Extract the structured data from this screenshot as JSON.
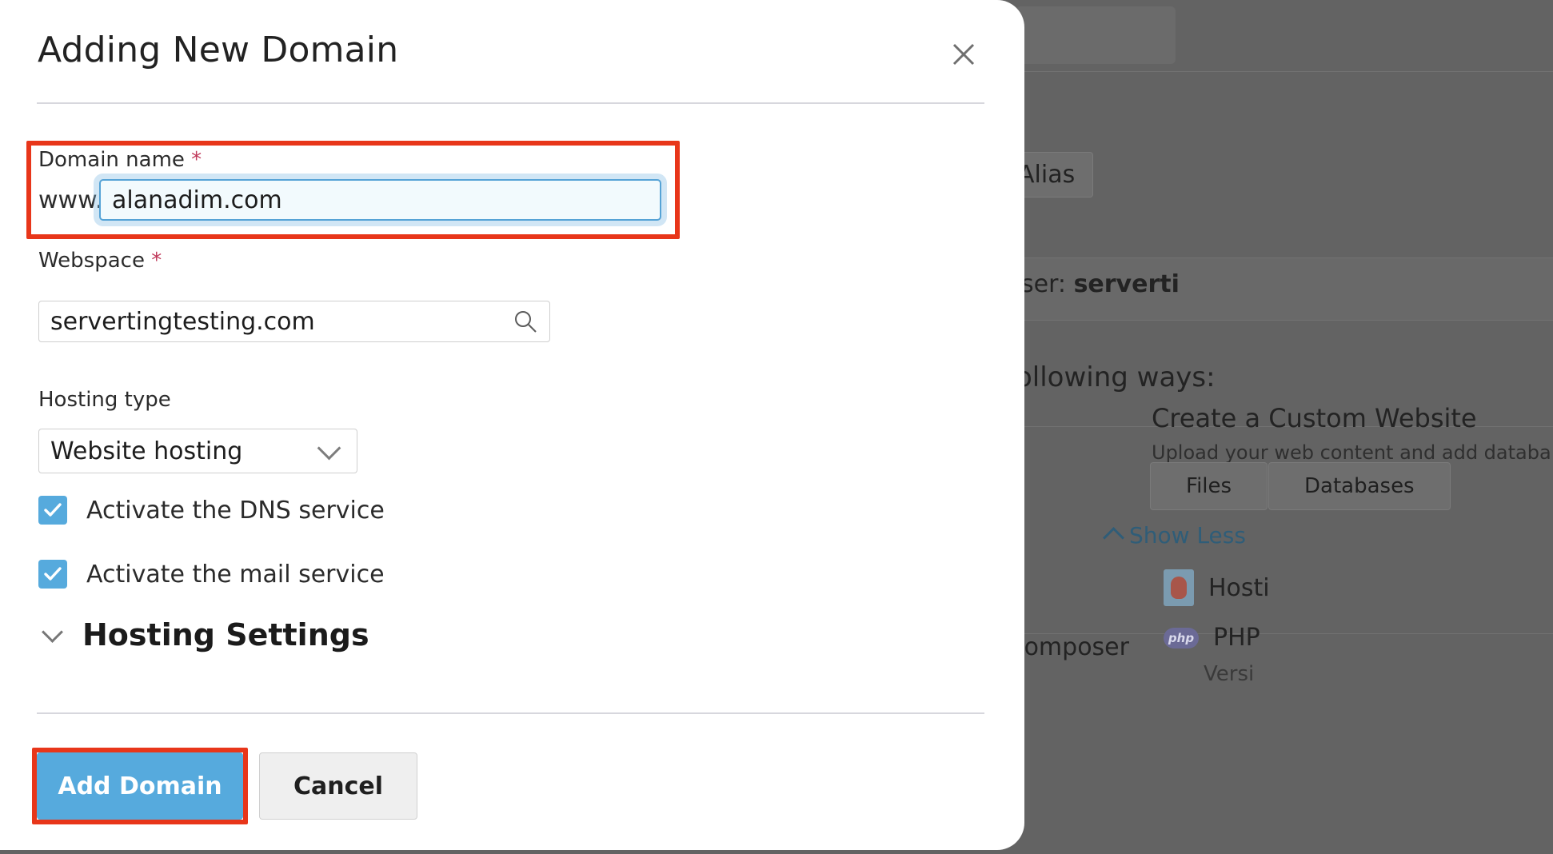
{
  "dialog": {
    "title": "Adding New Domain",
    "close_icon": "close-icon",
    "fields": {
      "domain": {
        "label": "Domain name",
        "required_marker": "*",
        "prefix": "www.",
        "value": "alanadim.com",
        "placeholder": ""
      },
      "webspace": {
        "label": "Webspace",
        "required_marker": "*",
        "value": "servertingtesting.com",
        "placeholder": "",
        "search_icon": "search-icon"
      },
      "hosting_type": {
        "label": "Hosting type",
        "selected": "Website hosting",
        "options": [
          "Website hosting"
        ],
        "chevron_icon": "chevron-down-icon"
      }
    },
    "checkboxes": [
      {
        "label": "Activate the DNS service",
        "checked": true
      },
      {
        "label": "Activate the mail service",
        "checked": true
      }
    ],
    "accordion": {
      "title": "Hosting Settings",
      "chevron_icon": "chevron-down-icon",
      "expanded": false
    },
    "buttons": {
      "primary": "Add Domain",
      "secondary": "Cancel"
    },
    "highlights": {
      "color": "#e8361a",
      "targets": [
        "domain-name-field",
        "add-domain-button"
      ]
    }
  },
  "background": {
    "alias_button": "Alias",
    "user_prefix": "user:",
    "user_name": "serverti",
    "ways_text": "following ways:",
    "custom_website": {
      "title": "Create a Custom Website",
      "subtitle": "Upload your web content and add databa",
      "buttons": [
        "Files",
        "Databases"
      ]
    },
    "show_less": "Show Less",
    "hosting_label": "Hosti",
    "composer_label": "P Composer",
    "php_label": "PHP",
    "php_version": "Versi",
    "php_badge": "php",
    "overlay_color": "#636363"
  },
  "colors": {
    "accent": "#56aadd",
    "highlight": "#e8361a",
    "required": "#c0395a",
    "link": "#2f5d78"
  }
}
